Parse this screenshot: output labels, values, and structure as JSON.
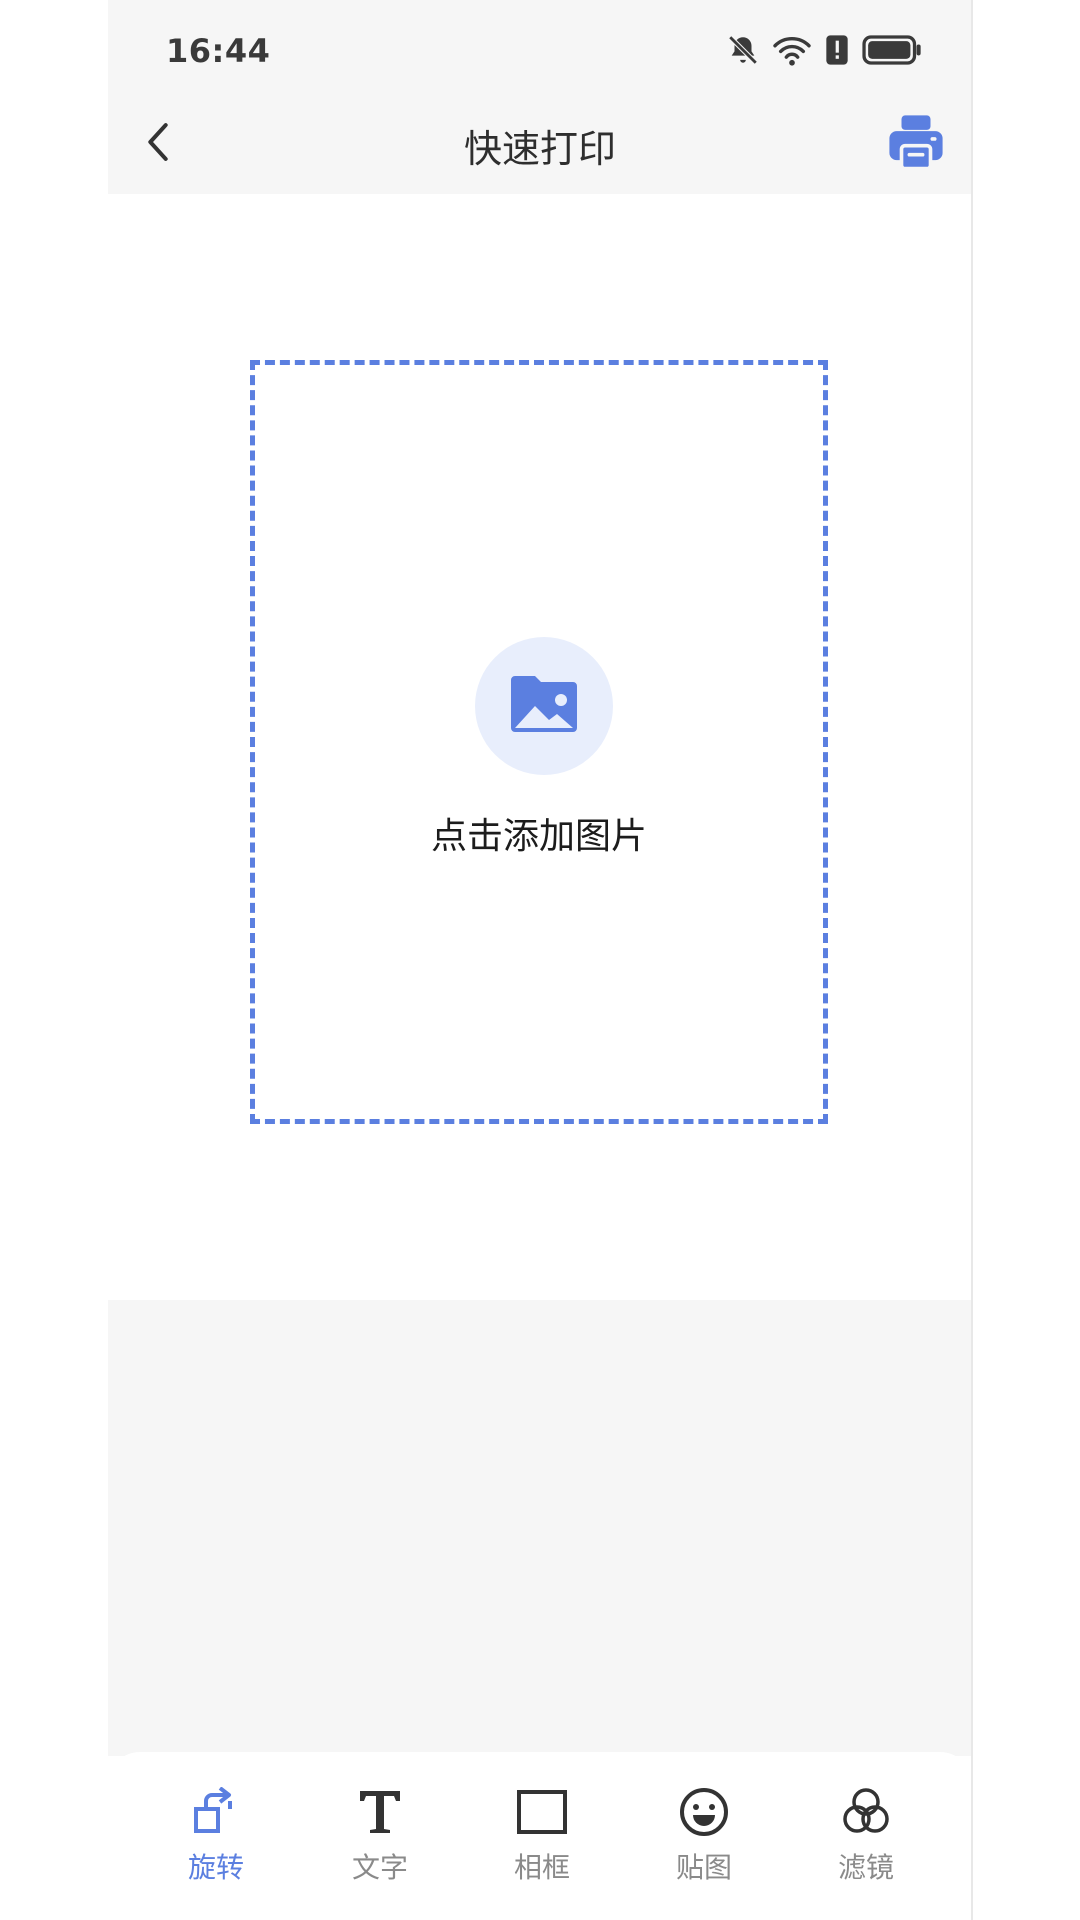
{
  "status_bar": {
    "time": "16:44",
    "icons": [
      "bell-off-icon",
      "wifi-icon",
      "alert-icon",
      "battery-icon"
    ]
  },
  "header": {
    "title": "快速打印",
    "back_icon": "chevron-left-icon",
    "print_icon": "printer-icon"
  },
  "canvas": {
    "add_label": "点击添加图片",
    "add_icon": "image-icon"
  },
  "toolbar": {
    "items": [
      {
        "label": "旋转",
        "icon": "rotate-icon",
        "active": true
      },
      {
        "label": "文字",
        "icon": "text-icon",
        "active": false
      },
      {
        "label": "相框",
        "icon": "frame-icon",
        "active": false
      },
      {
        "label": "贴图",
        "icon": "sticker-icon",
        "active": false
      },
      {
        "label": "滤镜",
        "icon": "filter-icon",
        "active": false
      }
    ]
  },
  "colors": {
    "accent": "#5b7fe0",
    "accent_light": "#e8eefc",
    "bar_bg": "#f6f6f6",
    "inactive": "#8a8a8a"
  }
}
